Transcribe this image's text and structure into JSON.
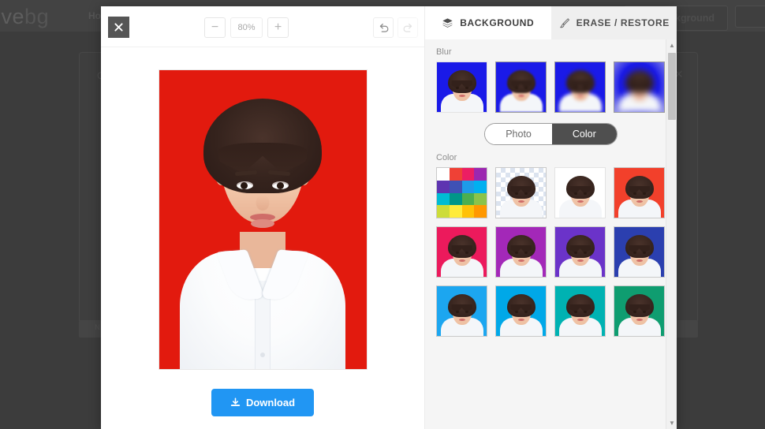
{
  "background_page": {
    "logo_part_dark": "ove",
    "logo_part_light": "bg",
    "nav_item": "Ho",
    "remove_background_button": "ove Background",
    "panel_label": "C",
    "panel_close": "×",
    "footer_text": "N"
  },
  "editor": {
    "close_button_name": "close",
    "zoom": {
      "minus_label": "−",
      "level": "80%",
      "plus_label": "+"
    },
    "history": {
      "undo_name": "undo",
      "redo_name": "redo"
    },
    "download_button": "Download",
    "canvas": {
      "background_color": "#E21A0E",
      "subject": "portrait photo"
    }
  },
  "panel": {
    "tabs": [
      {
        "label": "BACKGROUND",
        "icon": "layers-icon",
        "active": true
      },
      {
        "label": "ERASE / RESTORE",
        "icon": "brush-icon",
        "active": false
      }
    ],
    "blur_section": {
      "label": "Blur",
      "items": [
        {
          "name": "blur-none",
          "color": "#1a1ae8",
          "blur": 0,
          "selected": false,
          "pale_border": true
        },
        {
          "name": "blur-light",
          "color": "#1a1ae8",
          "blur": 1,
          "selected": true,
          "pale_border": false
        },
        {
          "name": "blur-medium",
          "color": "#1a1ae8",
          "blur": 2,
          "selected": true,
          "pale_border": false
        },
        {
          "name": "blur-strong",
          "color": "#1a1ae8",
          "blur": 4,
          "selected": true,
          "pale_border": false
        }
      ]
    },
    "source_toggle": {
      "options": [
        "Photo",
        "Color"
      ],
      "selected": "Color"
    },
    "color_section": {
      "label": "Color",
      "palette_swatches": [
        "#ffffff",
        "#ef4136",
        "#ec1e63",
        "#9c27b0",
        "#5e35b1",
        "#3f51b5",
        "#1e9be9",
        "#00b0f0",
        "#00bcd4",
        "#009688",
        "#4caf50",
        "#8bc34a",
        "#cddc39",
        "#ffeb3b",
        "#ffc107",
        "#ff9800"
      ],
      "items": [
        {
          "name": "transparent",
          "color": "transparent",
          "checker": true
        },
        {
          "name": "white",
          "color": "#ffffff"
        },
        {
          "name": "red-orange",
          "color": "#f2402b"
        },
        {
          "name": "pink-crimson",
          "color": "#ec1a5c"
        },
        {
          "name": "purple",
          "color": "#a328b8"
        },
        {
          "name": "violet",
          "color": "#6b33c9"
        },
        {
          "name": "indigo",
          "color": "#2b3faf"
        },
        {
          "name": "bright-blue",
          "color": "#1ca6f0"
        },
        {
          "name": "sky-blue",
          "color": "#00a8e8"
        },
        {
          "name": "teal",
          "color": "#00b2b2"
        },
        {
          "name": "green-teal",
          "color": "#0f9d70"
        }
      ]
    },
    "scrollbar": {
      "up_arrow": "▲",
      "down_arrow": "▼"
    }
  }
}
